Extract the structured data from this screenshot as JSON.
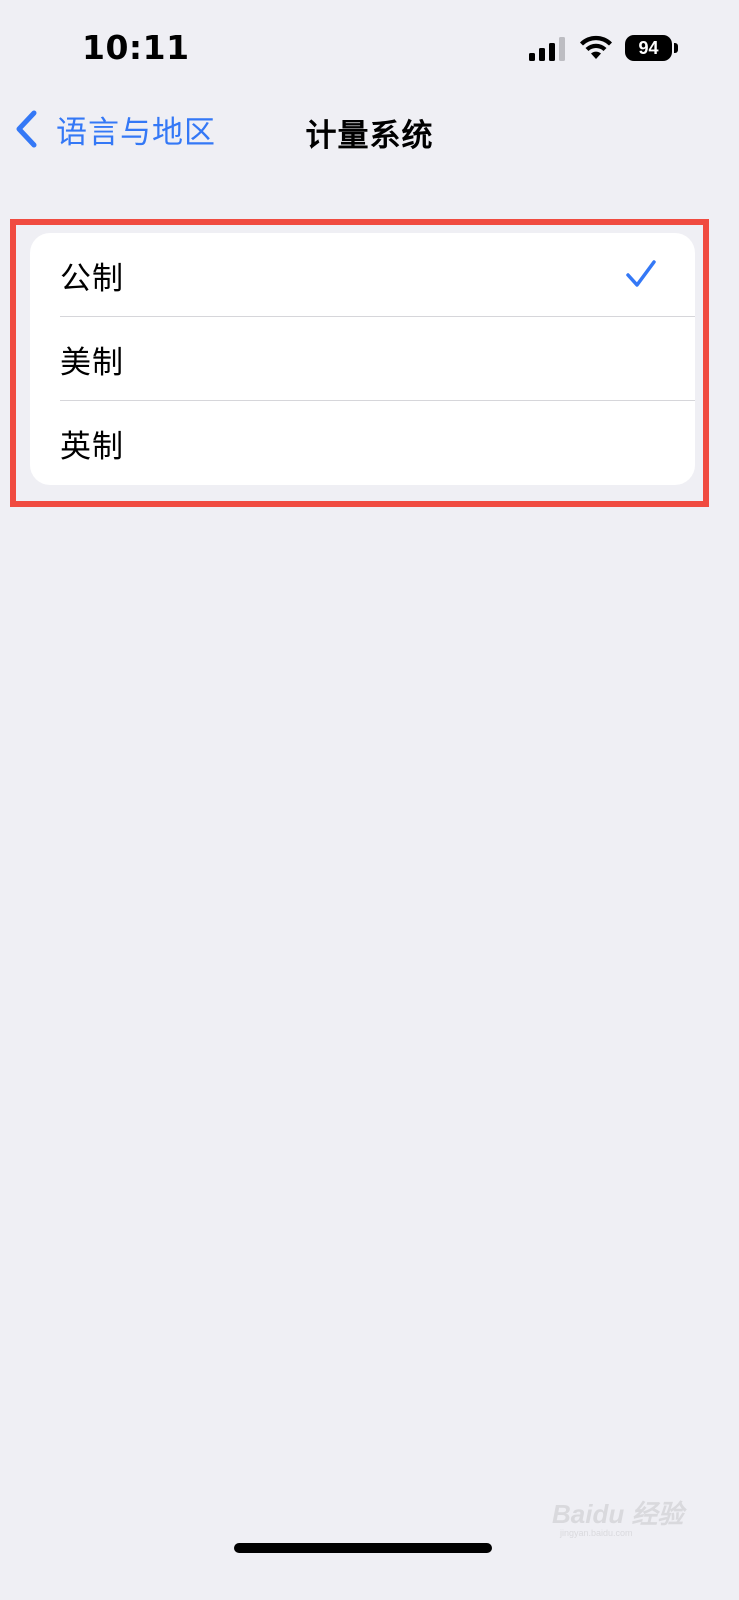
{
  "status_bar": {
    "time": "10:11",
    "battery_level": "94"
  },
  "nav": {
    "back_label": "语言与地区",
    "title": "计量系统"
  },
  "options": [
    {
      "label": "公制",
      "selected": true
    },
    {
      "label": "美制",
      "selected": false
    },
    {
      "label": "英制",
      "selected": false
    }
  ],
  "colors": {
    "accent": "#3478f6",
    "background": "#efeff4",
    "highlight_frame": "#f04b40"
  },
  "watermark": {
    "text": "Baidu 经验",
    "subtext": "jingyan.baidu.com"
  }
}
